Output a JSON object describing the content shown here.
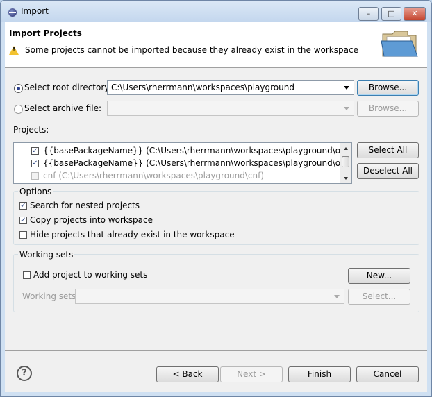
{
  "window": {
    "title": "Import",
    "minimize": "–",
    "maximize": "□",
    "close": "✕"
  },
  "header": {
    "title": "Import Projects",
    "message": "Some projects cannot be imported because they already exist in the workspace"
  },
  "source": {
    "root_label": "Select root directory:",
    "root_value": "C:\\Users\\rherrmann\\workspaces\\playground",
    "root_browse": "Browse...",
    "archive_label": "Select archive file:",
    "archive_value": "",
    "archive_browse": "Browse..."
  },
  "projects": {
    "label": "Projects:",
    "items": [
      {
        "text": "{{basePackageName}} (C:\\Users\\rherrmann\\workspaces\\playground\\org.example.",
        "checked": true,
        "enabled": true
      },
      {
        "text": "{{basePackageName}} (C:\\Users\\rherrmann\\workspaces\\playground\\org.example.",
        "checked": true,
        "enabled": true
      },
      {
        "text": "cnf (C:\\Users\\rherrmann\\workspaces\\playground\\cnf)",
        "checked": false,
        "enabled": false
      }
    ],
    "select_all": "Select All",
    "deselect_all": "Deselect All"
  },
  "options": {
    "title": "Options",
    "search_nested": "Search for nested projects",
    "copy_into": "Copy projects into workspace",
    "hide_existing": "Hide projects that already exist in the workspace",
    "search_nested_checked": true,
    "copy_into_checked": true,
    "hide_existing_checked": false
  },
  "working_sets": {
    "title": "Working sets",
    "add_label": "Add project to working sets",
    "add_checked": false,
    "new_button": "New...",
    "sets_label": "Working sets:",
    "sets_value": "",
    "select_button": "Select..."
  },
  "footer": {
    "help": "?",
    "back": "< Back",
    "next": "Next >",
    "finish": "Finish",
    "cancel": "Cancel"
  },
  "colors": {
    "warning": "#f2c230",
    "focus_border": "#3c7fb1"
  }
}
